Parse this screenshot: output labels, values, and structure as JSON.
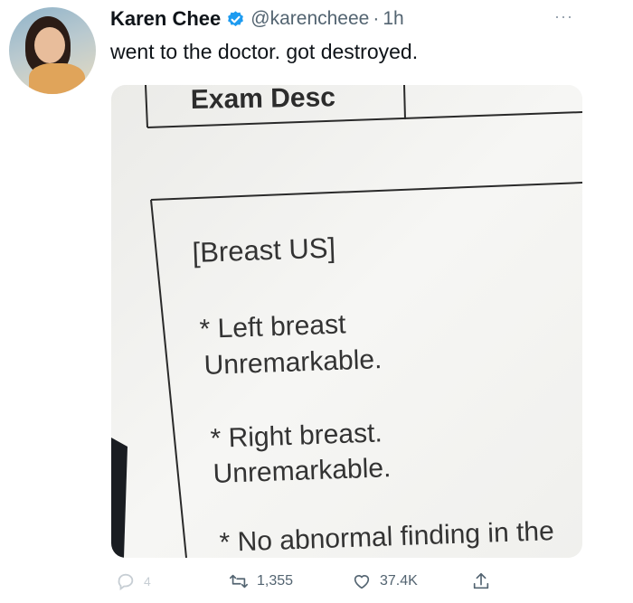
{
  "author": {
    "name": "Karen Chee",
    "handle": "@karencheee",
    "separator": "·",
    "time": "1h"
  },
  "tweet": {
    "text": "went to the doctor. got destroyed."
  },
  "photo": {
    "header_label": "Exam Desc",
    "lines": [
      "[Breast US]",
      "* Left breast",
      "Unremarkable.",
      "* Right breast.",
      "Unremarkable.",
      "* No abnormal finding in the"
    ]
  },
  "actions": {
    "reply_count": "4",
    "retweet_count": "1,355",
    "like_count": "37.4K"
  },
  "colors": {
    "verified": "#1d9bf0",
    "muted": "#536471"
  },
  "icons": [
    "verified-badge-icon",
    "more-icon",
    "reply-icon",
    "retweet-icon",
    "like-icon",
    "share-icon"
  ]
}
